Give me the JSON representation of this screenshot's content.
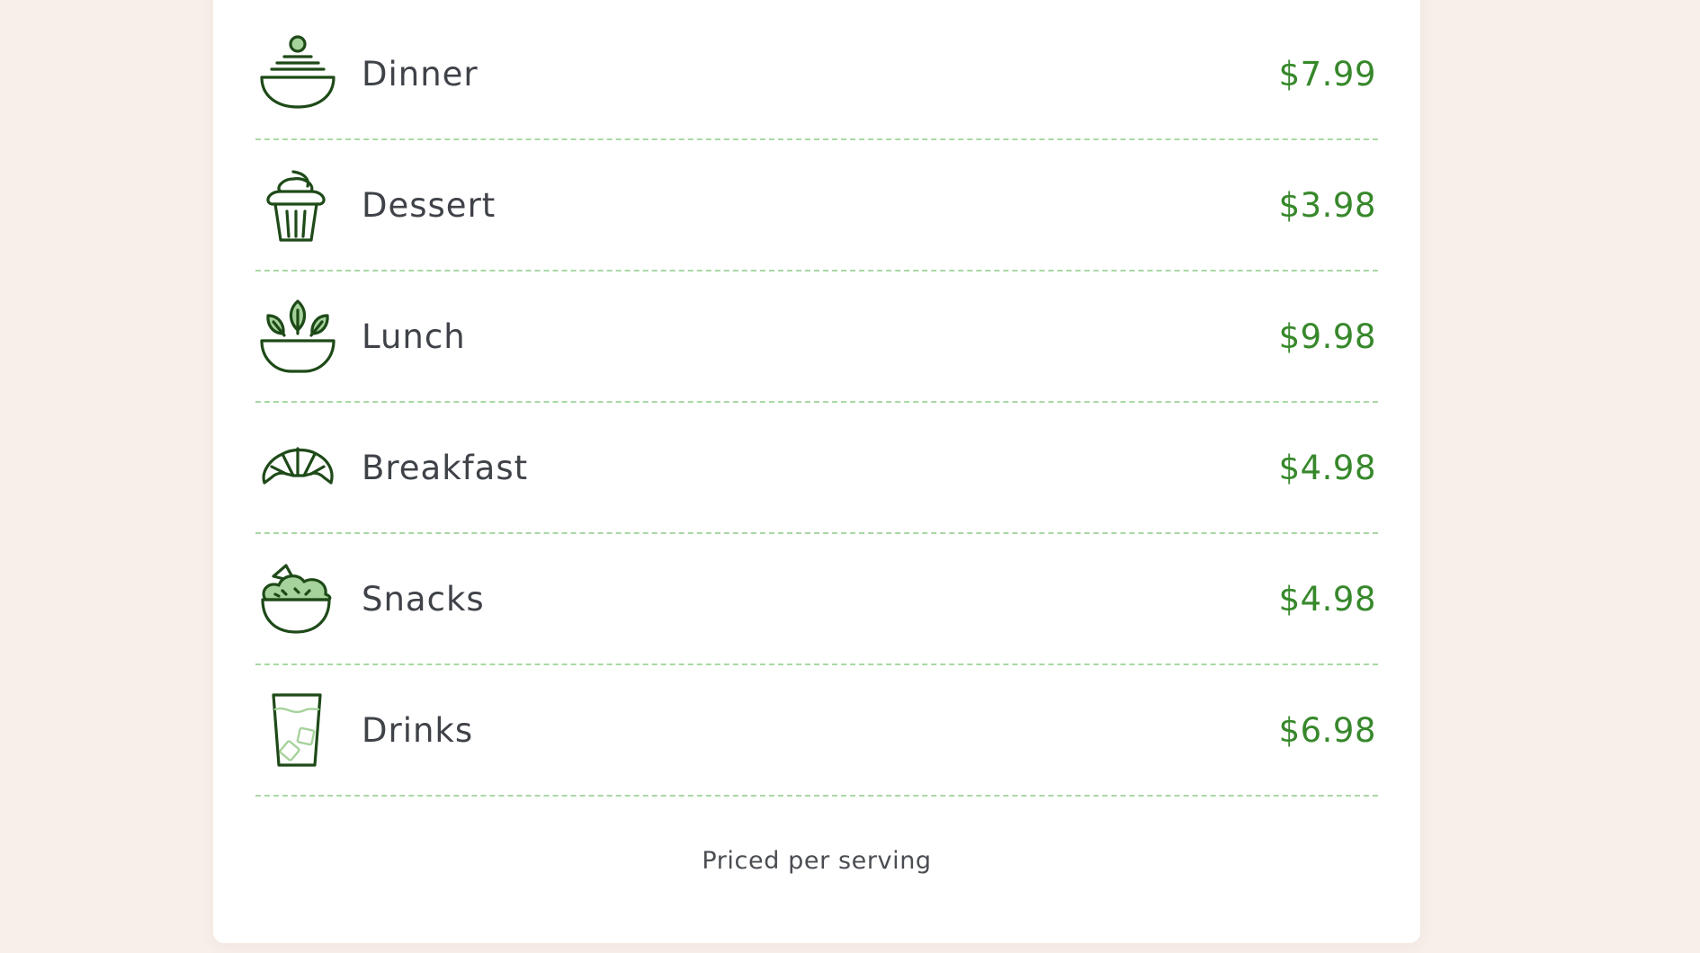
{
  "menu": {
    "items": [
      {
        "name": "Dinner",
        "price": "$7.99",
        "icon": "noodle-bowl-icon"
      },
      {
        "name": "Dessert",
        "price": "$3.98",
        "icon": "cupcake-icon"
      },
      {
        "name": "Lunch",
        "price": "$9.98",
        "icon": "salad-bowl-icon"
      },
      {
        "name": "Breakfast",
        "price": "$4.98",
        "icon": "croissant-icon"
      },
      {
        "name": "Snacks",
        "price": "$4.98",
        "icon": "snack-bowl-icon"
      },
      {
        "name": "Drinks",
        "price": "$6.98",
        "icon": "iced-drink-icon"
      }
    ],
    "footer_note": "Priced per serving"
  },
  "colors": {
    "background": "#f8efea",
    "card": "#ffffff",
    "price": "#37882b",
    "divider": "#a9d8a4",
    "icon_stroke": "#1e4a18",
    "icon_fill": "#a6d39c"
  }
}
